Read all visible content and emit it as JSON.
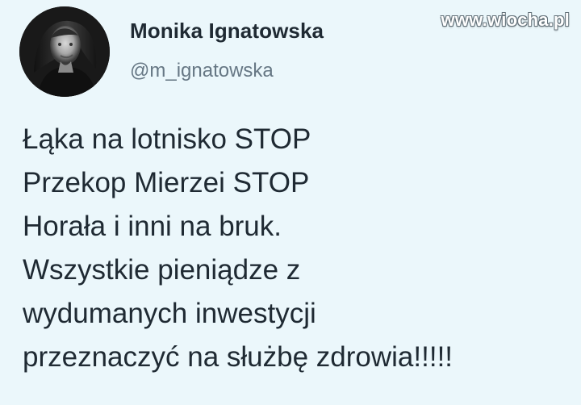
{
  "tweet": {
    "author": {
      "name": "Monika Ignatowska",
      "handle": "@m_ignatowska",
      "avatar_icon": "profile-photo"
    },
    "watermark": "www.wiocha.pl",
    "lines": [
      "Łąka na lotnisko STOP",
      "Przekop Mierzei STOP",
      "Horała i inni na bruk.",
      "Wszystkie pieniądze z",
      "wydumanych inwestycji",
      "przeznaczyć na służbę zdrowia!!!!!"
    ]
  },
  "colors": {
    "background": "#ebf7fb",
    "text": "#1f2a33",
    "handle": "#667784",
    "watermark": "#ffffff"
  }
}
